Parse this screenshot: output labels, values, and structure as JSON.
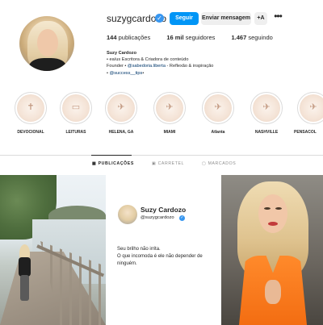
{
  "profile": {
    "username": "suzygcardozo",
    "follow_label": "Seguir",
    "message_label": "Enviar mensagem",
    "add_label": "+A",
    "more_label": "•••",
    "stats": {
      "posts_count": "144",
      "posts_label": "publicações",
      "followers_count": "16 mil",
      "followers_label": "seguidores",
      "following_count": "1.467",
      "following_label": "seguindo"
    },
    "bio": {
      "name": "Suzy Cardozo",
      "line1": "• ea/us Escritora & Criadora de conteúdo",
      "line2_prefix": "Founder • ",
      "line2_link": "@sabedoria.liberta",
      "line2_suffix": " - Reflexão & inspiração",
      "line3_prefix": "• ",
      "line3_link": "@success__tips",
      "line3_suffix": "•"
    }
  },
  "highlights": [
    {
      "label": "DEVOCIONAL",
      "icon": "cross-icon"
    },
    {
      "label": "LEITURAS",
      "icon": "book-icon"
    },
    {
      "label": "HELENA, GA",
      "icon": "plane-icon"
    },
    {
      "label": "MIAMI",
      "icon": "plane-icon"
    },
    {
      "label": "Atlanta",
      "icon": "plane-icon"
    },
    {
      "label": "NASHVILLE",
      "icon": "plane-icon"
    },
    {
      "label": "PENSACOL",
      "icon": "plane-icon"
    }
  ],
  "tabs": {
    "posts": "PUBLICAÇÕES",
    "reels": "CARRETEL",
    "tagged": "MARCADOS"
  },
  "posts": {
    "card_name": "Suzy Cardozo",
    "card_handle": "@suzygcardozo",
    "card_line1": "Seu brilho não irrita.",
    "card_line2": "O que incomoda é ele não depender de ninguém."
  },
  "colors": {
    "accent": "#0095f6",
    "verified": "#3897f0",
    "link": "#00376b"
  }
}
